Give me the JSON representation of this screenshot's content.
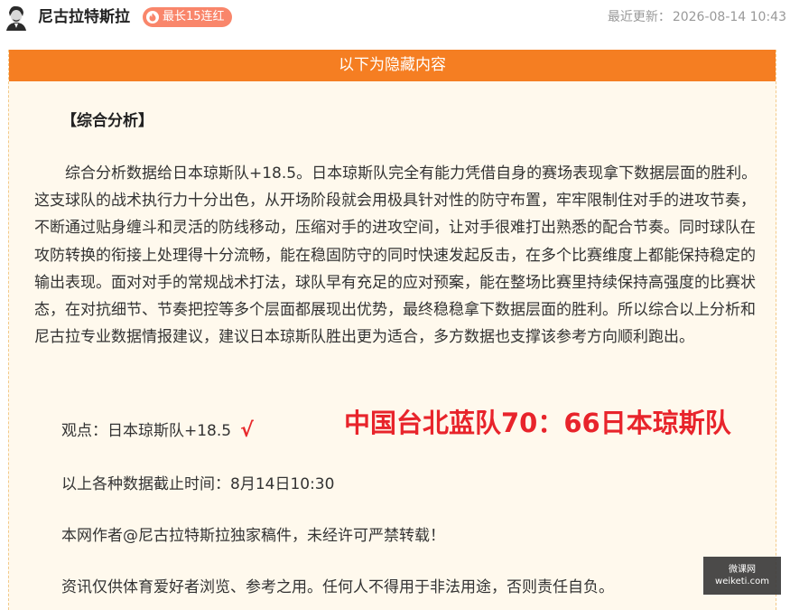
{
  "header": {
    "author": "尼古拉特斯拉",
    "streak_badge": "最长15连红",
    "updated_label": "最近更新：",
    "updated_time": "2026-08-14 10:43"
  },
  "article": {
    "hidden_banner": "以下为隐藏内容",
    "section_heading": "【综合分析】",
    "body": "综合分析数据给日本琼斯队+18.5。日本琼斯队完全有能力凭借自身的赛场表现拿下数据层面的胜利。这支球队的战术执行力十分出色，从开场阶段就会用极具针对性的防守布置，牢牢限制住对手的进攻节奏，不断通过贴身缠斗和灵活的防线移动，压缩对手的进攻空间，让对手很难打出熟悉的配合节奏。同时球队在攻防转换的衔接上处理得十分流畅，能在稳固防守的同时快速发起反击，在多个比赛维度上都能保持稳定的输出表现。面对对手的常规战术打法，球队早有充足的应对预案，能在整场比赛里持续保持高强度的比赛状态，在对抗细节、节奏把控等多个层面都展现出优势，最终稳稳拿下数据层面的胜利。所以综合以上分析和尼古拉专业数据情报建议，建议日本琼斯队胜出更为适合，多方数据也支撑该参考方向顺利跑出。",
    "viewpoint": "观点：日本琼斯队+18.5",
    "result_mark": "√",
    "final_score": "中国台北蓝队70：66日本琼斯队",
    "data_cutoff": "以上各种数据截止时间：8月14日10:30",
    "copyright": "本网作者@尼古拉特斯拉独家稿件，未经许可严禁转载！",
    "disclaimer": "资讯仅供体育爱好者浏览、参考之用。任何人不得用于非法用途，否则责任自负。"
  },
  "watermark": {
    "line1": "微课网",
    "line2": "weiketi.com"
  },
  "colors": {
    "banner": "#f57e22",
    "panel_bg": "#fff9ed",
    "badge": "#f9866b",
    "score_red": "#e8242b"
  }
}
